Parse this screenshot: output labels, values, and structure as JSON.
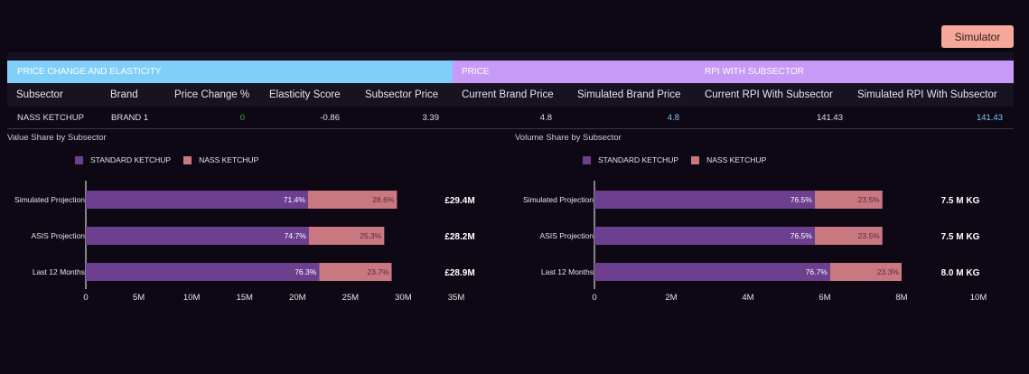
{
  "simulator_button": "Simulator",
  "colors": {
    "standard": "#6c3f8f",
    "nass": "#c97882",
    "accent": "#7fcff9",
    "price_group": "#c89af8"
  },
  "table": {
    "groups": [
      "PRICE CHANGE AND ELASTICITY",
      "PRICE",
      "RPI WITH SUBSECTOR"
    ],
    "headers": [
      "Subsector",
      "Brand",
      "Price Change %",
      "Elasticity Score",
      "Subsector Price",
      "Current Brand Price",
      "Simulated Brand Price",
      "Current RPI With Subsector",
      "Simulated RPI With Subsector"
    ],
    "row": {
      "subsector": "NASS KETCHUP",
      "brand": "BRAND 1",
      "price_change": "0",
      "elasticity": "-0.86",
      "subsector_price": "3.39",
      "current_brand_price": "4.8",
      "simulated_brand_price": "4.8",
      "current_rpi": "141.43",
      "simulated_rpi": "141.43"
    }
  },
  "chart_data": [
    {
      "type": "bar",
      "title": "Value Share by Subsector",
      "categories": [
        "Simulated Projection",
        "ASIS Projection",
        "Last 12 Months"
      ],
      "series": [
        {
          "name": "STANDARD KETCHUP",
          "values": [
            71.4,
            74.7,
            76.3
          ],
          "labels": [
            "71.4%",
            "74.7%",
            "76.3%"
          ]
        },
        {
          "name": "NASS KETCHUP",
          "values": [
            28.6,
            25.3,
            23.7
          ],
          "labels": [
            "28.6%",
            "25.3%",
            "23.7%"
          ]
        }
      ],
      "totals": [
        29.4,
        28.2,
        28.9
      ],
      "total_labels": [
        "£29.4M",
        "£28.2M",
        "£28.9M"
      ],
      "xlim": [
        0,
        35
      ],
      "xticks": [
        0,
        5,
        10,
        15,
        20,
        25,
        30,
        35
      ],
      "xtick_labels": [
        "0",
        "5M",
        "10M",
        "15M",
        "20M",
        "25M",
        "30M",
        "35M"
      ],
      "legend": "top"
    },
    {
      "type": "bar",
      "title": "Volume Share by Subsector",
      "categories": [
        "Simulated Projection",
        "ASIS Projection",
        "Last 12 Months"
      ],
      "series": [
        {
          "name": "STANDARD KETCHUP",
          "values": [
            76.5,
            76.5,
            76.7
          ],
          "labels": [
            "76.5%",
            "76.5%",
            "76.7%"
          ]
        },
        {
          "name": "NASS KETCHUP",
          "values": [
            23.5,
            23.5,
            23.3
          ],
          "labels": [
            "23.5%",
            "23.5%",
            "23.3%"
          ]
        }
      ],
      "totals": [
        7.5,
        7.5,
        8.0
      ],
      "total_labels": [
        "7.5 M KG",
        "7.5 M KG",
        "8.0 M KG"
      ],
      "xlim": [
        0,
        10
      ],
      "xticks": [
        0,
        2,
        4,
        6,
        8,
        10
      ],
      "xtick_labels": [
        "0",
        "2M",
        "4M",
        "6M",
        "8M",
        "10M"
      ],
      "legend": "top"
    }
  ]
}
